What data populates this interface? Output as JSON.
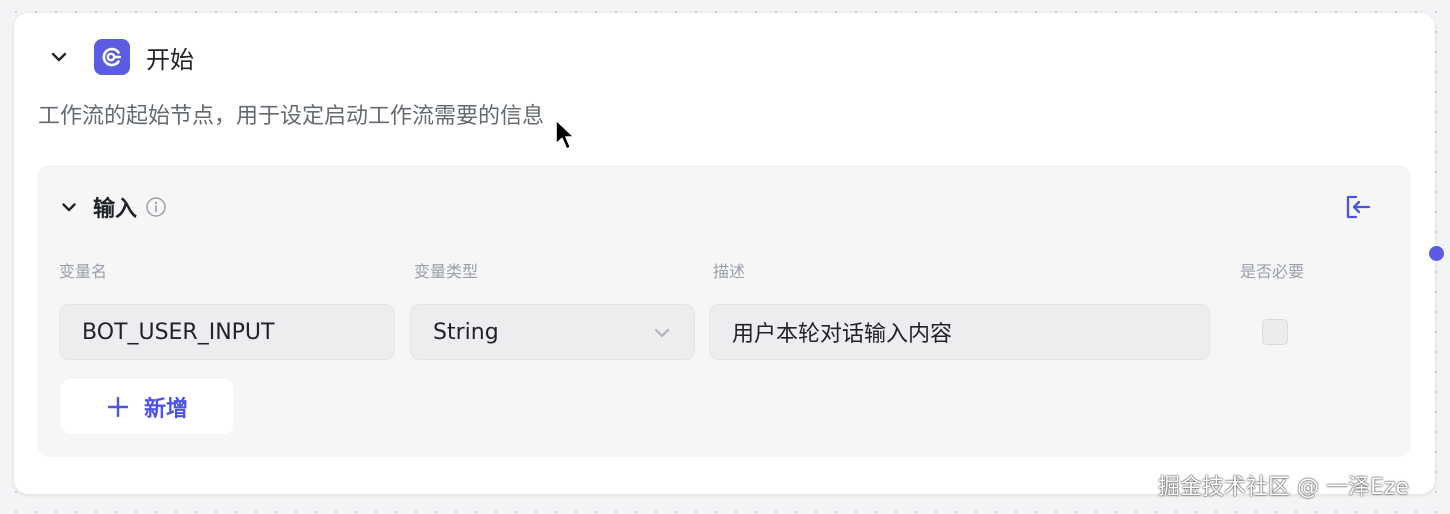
{
  "node": {
    "title": "开始",
    "description": "工作流的起始节点，用于设定启动工作流需要的信息",
    "accent_color": "#5b5ce2"
  },
  "input_section": {
    "title": "输入",
    "columns": {
      "name": "变量名",
      "type": "变量类型",
      "description": "描述",
      "required": "是否必要"
    },
    "rows": [
      {
        "name": "BOT_USER_INPUT",
        "type": "String",
        "description": "用户本轮对话输入内容",
        "required": false
      }
    ],
    "add_button_label": "新增",
    "icons": {
      "info": "info-icon",
      "collapse": "collapse-panel-icon",
      "plus": "plus-icon"
    }
  },
  "watermark": "掘金技术社区 @ 一泽Eze"
}
